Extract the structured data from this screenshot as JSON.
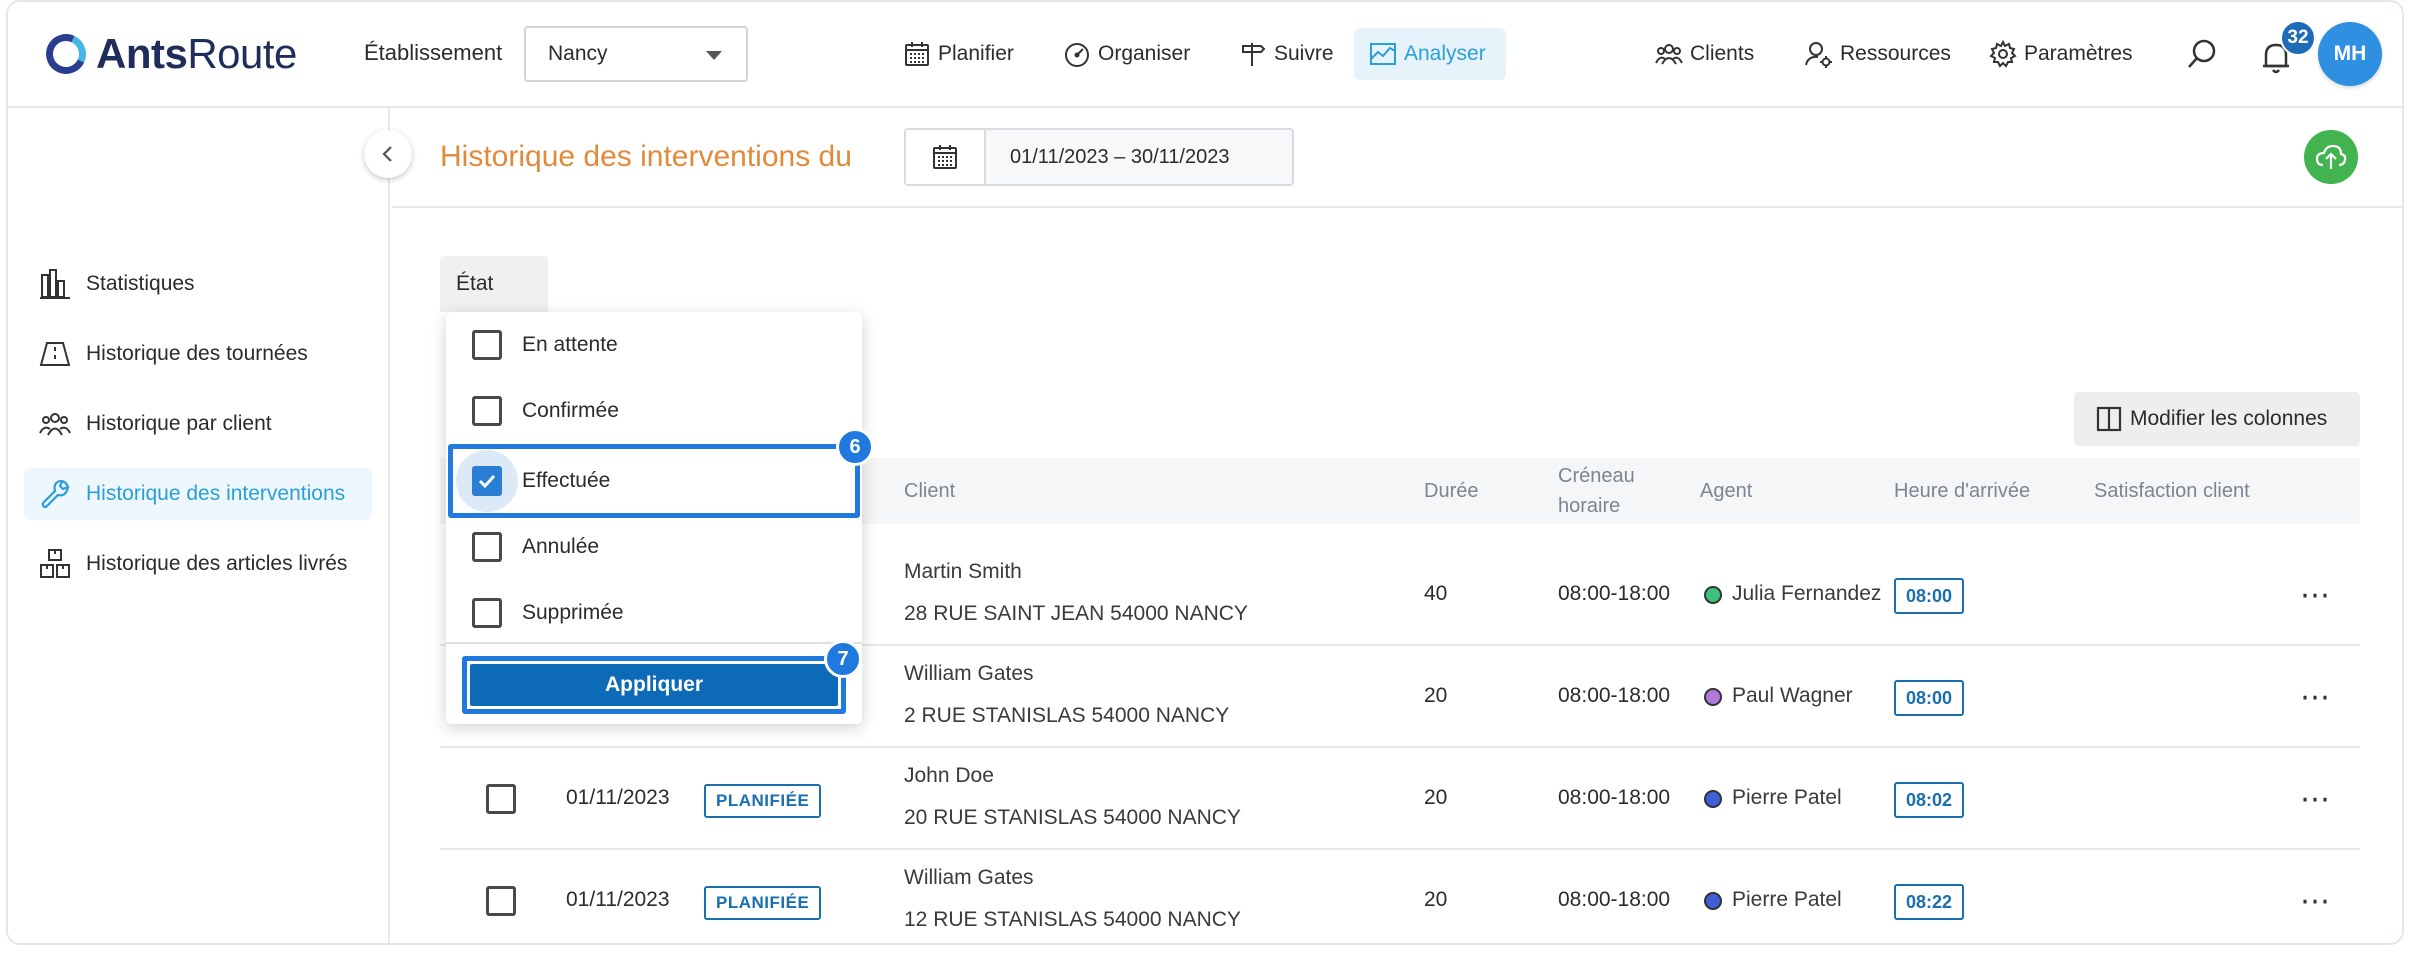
{
  "app": {
    "logo_bold": "Ants",
    "logo_light": "Route"
  },
  "header": {
    "etablissement_label": "Établissement",
    "etablissement_value": "Nancy",
    "nav": [
      {
        "label": "Planifier",
        "icon": "calendar-icon"
      },
      {
        "label": "Organiser",
        "icon": "gauge-icon"
      },
      {
        "label": "Suivre",
        "icon": "signpost-icon"
      },
      {
        "label": "Analyser",
        "icon": "chart-icon",
        "active": true
      }
    ],
    "right_nav": [
      {
        "label": "Clients",
        "icon": "people-icon"
      },
      {
        "label": "Ressources",
        "icon": "user-gear-icon"
      },
      {
        "label": "Paramètres",
        "icon": "gear-icon"
      }
    ],
    "notifications_count": "32",
    "avatar_initials": "MH"
  },
  "sidebar": {
    "items": [
      {
        "label": "Statistiques",
        "icon": "bar-chart-icon"
      },
      {
        "label": "Historique des tournées",
        "icon": "road-icon"
      },
      {
        "label": "Historique par client",
        "icon": "people-icon"
      },
      {
        "label": "Historique des interventions",
        "icon": "wrench-icon",
        "active": true
      },
      {
        "label": "Historique des articles livrés",
        "icon": "boxes-icon"
      }
    ]
  },
  "main": {
    "title": "Historique des interventions du",
    "date_range": "01/11/2023 – 30/11/2023",
    "filter_label": "État",
    "modify_columns": "Modifier les colonnes",
    "columns": {
      "client": "Client",
      "duree": "Durée",
      "creneau_1": "Créneau",
      "creneau_2": "horaire",
      "agent": "Agent",
      "arrivee": "Heure d'arrivée",
      "satisfaction": "Satisfaction client"
    },
    "rows": [
      {
        "date": "",
        "status": "",
        "client": "Martin Smith",
        "address": "28 RUE SAINT JEAN 54000 NANCY",
        "duree": "40",
        "creneau": "08:00-18:00",
        "agent": "Julia Fernandez",
        "agent_color": "#3cc07a",
        "arrivee": "08:00"
      },
      {
        "date": "",
        "status": "",
        "client": "William Gates",
        "address": "2 RUE STANISLAS 54000 NANCY",
        "duree": "20",
        "creneau": "08:00-18:00",
        "agent": "Paul Wagner",
        "agent_color": "#b07ad8",
        "arrivee": "08:00"
      },
      {
        "date": "01/11/2023",
        "status": "PLANIFIÉE",
        "client": "John Doe",
        "address": "20 RUE STANISLAS 54000 NANCY",
        "duree": "20",
        "creneau": "08:00-18:00",
        "agent": "Pierre Patel",
        "agent_color": "#3f5fd8",
        "arrivee": "08:02"
      },
      {
        "date": "01/11/2023",
        "status": "PLANIFIÉE",
        "client": "William Gates",
        "address": "12 RUE STANISLAS 54000 NANCY",
        "duree": "20",
        "creneau": "08:00-18:00",
        "agent": "Pierre Patel",
        "agent_color": "#3f5fd8",
        "arrivee": "08:22"
      }
    ]
  },
  "dropdown": {
    "options": [
      {
        "label": "En attente",
        "checked": false
      },
      {
        "label": "Confirmée",
        "checked": false
      },
      {
        "label": "Effectuée",
        "checked": true
      },
      {
        "label": "Annulée",
        "checked": false
      },
      {
        "label": "Supprimée",
        "checked": false
      }
    ],
    "apply_label": "Appliquer",
    "step_option": "6",
    "step_apply": "7"
  },
  "colors": {
    "accent": "#2a9fd8",
    "title": "#e08a3c",
    "primary_button": "#0d6ab6",
    "highlight": "#1f79de",
    "cloud": "#41b34f"
  }
}
